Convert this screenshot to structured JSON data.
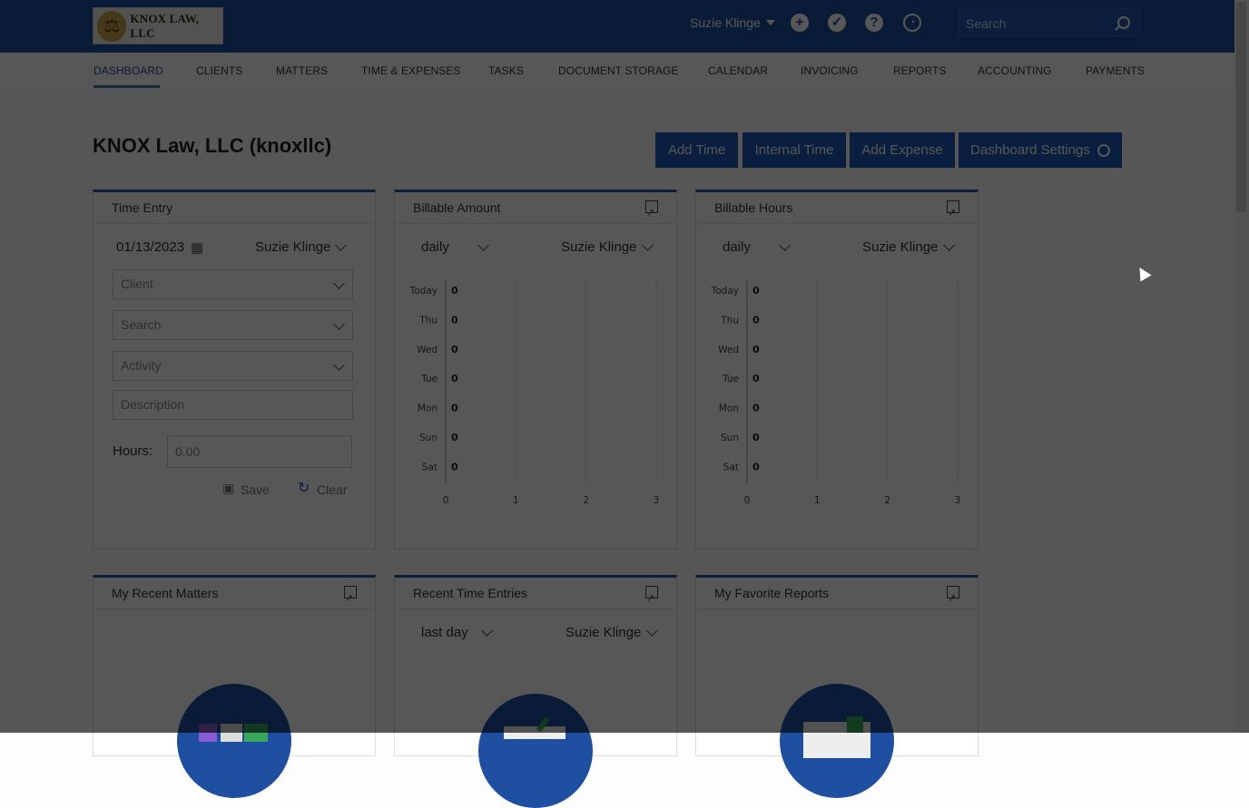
{
  "header": {
    "logo_text": "KNOX LAW, LLC",
    "user_name": "Suzie Klinge",
    "search_placeholder": "Search"
  },
  "nav": {
    "items": [
      "DASHBOARD",
      "CLIENTS",
      "MATTERS",
      "TIME & EXPENSES",
      "TASKS",
      "DOCUMENT STORAGE",
      "CALENDAR",
      "INVOICING",
      "REPORTS",
      "ACCOUNTING",
      "PAYMENTS"
    ],
    "active": "DASHBOARD"
  },
  "page": {
    "title": "KNOX Law, LLC (knoxllc)",
    "buttons": {
      "add_time": "Add Time",
      "internal_time": "Internal Time",
      "add_expense": "Add Expense",
      "dashboard_settings": "Dashboard Settings"
    }
  },
  "time_entry": {
    "title": "Time Entry",
    "date": "01/13/2023",
    "user": "Suzie Klinge",
    "client_placeholder": "Client",
    "search_placeholder": "Search",
    "activity_placeholder": "Activity",
    "description_placeholder": "Description",
    "hours_label": "Hours:",
    "hours_placeholder": "0.00",
    "save_label": "Save",
    "clear_label": "Clear"
  },
  "billable_amount": {
    "title": "Billable Amount",
    "period": "daily",
    "user": "Suzie Klinge"
  },
  "billable_hours": {
    "title": "Billable Hours",
    "period": "daily",
    "user": "Suzie Klinge"
  },
  "recent_matters": {
    "title": "My Recent Matters"
  },
  "recent_time_entries": {
    "title": "Recent Time Entries",
    "period": "last day",
    "user": "Suzie Klinge"
  },
  "favorite_reports": {
    "title": "My Favorite Reports"
  },
  "chart_data": [
    {
      "type": "bar",
      "orientation": "horizontal",
      "categories": [
        "Today",
        "Thu",
        "Wed",
        "Tue",
        "Mon",
        "Sun",
        "Sat"
      ],
      "values": [
        0,
        0,
        0,
        0,
        0,
        0,
        0
      ],
      "xlabel": "Billable Amount",
      "xticks": [
        0,
        1,
        2,
        3
      ],
      "xlim": [
        0,
        3
      ],
      "grid": true
    },
    {
      "type": "bar",
      "orientation": "horizontal",
      "categories": [
        "Today",
        "Thu",
        "Wed",
        "Tue",
        "Mon",
        "Sun",
        "Sat"
      ],
      "values": [
        0,
        0,
        0,
        0,
        0,
        0,
        0
      ],
      "xlabel": "Billable Hours",
      "xticks": [
        0,
        1,
        2,
        3
      ],
      "xlim": [
        0,
        3
      ],
      "grid": true
    }
  ]
}
